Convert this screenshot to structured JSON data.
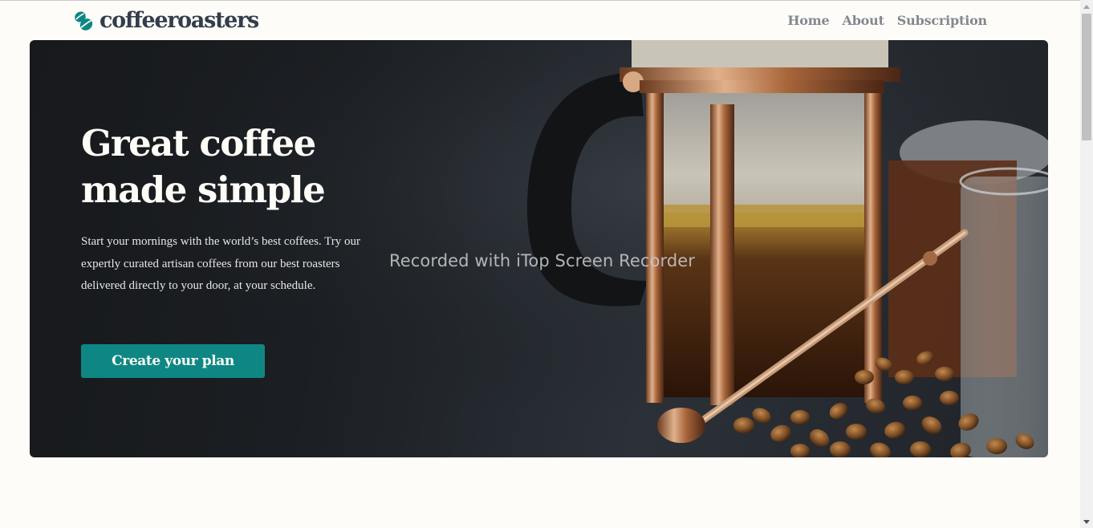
{
  "brand": {
    "name": "coffeeroasters",
    "accent_color": "#0e8784",
    "text_color": "#333d4b"
  },
  "nav": {
    "items": [
      {
        "label": "Home"
      },
      {
        "label": "About"
      },
      {
        "label": "Subscription"
      }
    ]
  },
  "hero": {
    "title_line1": "Great coffee",
    "title_line2": "made simple",
    "description": "Start your mornings with the world’s best coffees. Try our expertly curated artisan coffees from our best roasters delivered directly to your door, at your schedule.",
    "cta_label": "Create your plan",
    "image_subject": "french press with coffee beans"
  },
  "overlay": {
    "watermark": "Recorded with iTop Screen Recorder"
  },
  "icons": {
    "logo": "coffee-bean-icon",
    "scroll_up": "arrow-up-icon",
    "scroll_down": "arrow-down-icon"
  }
}
